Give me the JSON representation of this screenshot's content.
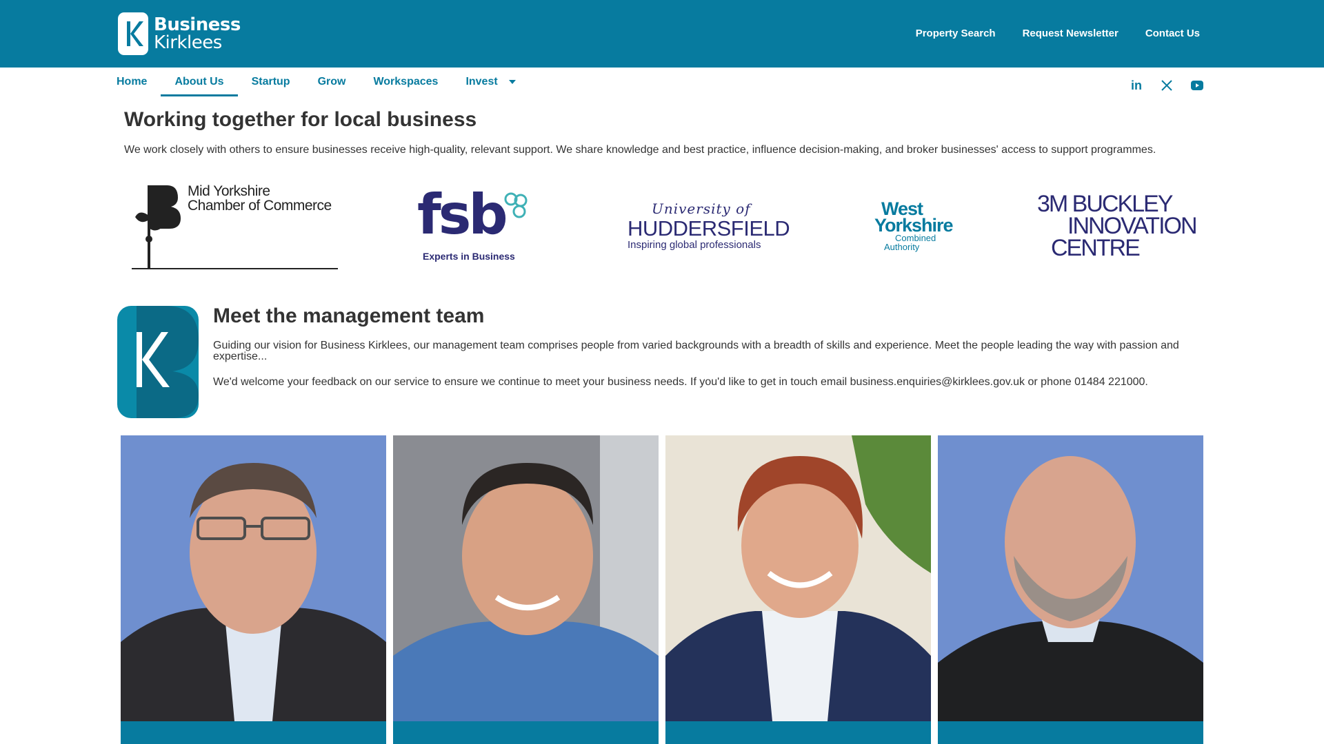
{
  "header": {
    "logo": {
      "line1": "Business",
      "line2": "Kirklees"
    },
    "links": [
      "Property Search",
      "Request Newsletter",
      "Contact Us"
    ]
  },
  "nav": {
    "items": [
      "Home",
      "About Us",
      "Startup",
      "Grow",
      "Workspaces",
      "Invest"
    ],
    "active": "About Us"
  },
  "social": {
    "icons": [
      "linkedin-icon",
      "x-twitter-icon",
      "youtube-icon"
    ],
    "linkedin_glyph": "in",
    "x_glyph": "𝕏",
    "youtube_glyph": "▶"
  },
  "partners_section": {
    "title": "Working together for local business",
    "text": "We work closely with others to ensure businesses receive high-quality, relevant support. We share knowledge and best practice, influence decision-making, and broker businesses' access to support programmes.",
    "partners": [
      {
        "name": "Mid Yorkshire Chamber of Commerce",
        "line1": "Mid Yorkshire",
        "line2": "Chamber of Commerce"
      },
      {
        "name": "fsb",
        "logo_text": "fsb",
        "tagline": "Experts in Business"
      },
      {
        "name": "University of Huddersfield",
        "line1": "University of",
        "line2": "HUDDERSFIELD",
        "tagline": "Inspiring global professionals"
      },
      {
        "name": "West Yorkshire Combined Authority",
        "line1": "West",
        "line2": "Yorkshire",
        "line3": "Combined",
        "line4": "Authority"
      },
      {
        "name": "3M Buckley Innovation Centre",
        "line1": "3M BUCKLEY",
        "line2": "INNOVATION",
        "line3": "CENTRE"
      }
    ]
  },
  "team_section": {
    "title": "Meet the management team",
    "text1": "Guiding our vision for Business Kirklees, our management team comprises people from varied backgrounds with a breadth of skills and experience. Meet the people leading the way with passion and expertise...",
    "text2": "We'd welcome your feedback on our service to ensure we continue to meet your business needs. If you'd like to get in touch email business.enquiries@kirklees.gov.uk or phone 01484 221000."
  },
  "colors": {
    "brand": "#077b9f",
    "text": "#333333",
    "navy": "#2b2a73"
  }
}
